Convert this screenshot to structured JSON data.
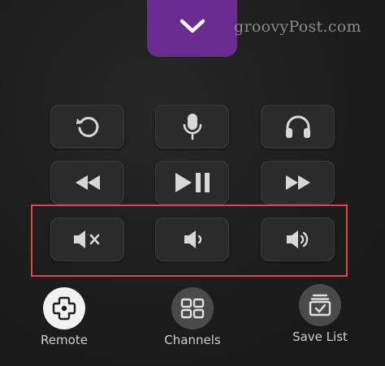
{
  "watermark": "groovyPost.com",
  "colors": {
    "accent": "#6a2c91",
    "highlight": "#e2444b",
    "button_bg": "#2b2b2b",
    "icon": "#d8d8d8"
  },
  "top_button": {
    "icon": "chevron-down-icon"
  },
  "rows": [
    [
      "replay-icon",
      "microphone-icon",
      "headphones-icon"
    ],
    [
      "rewind-icon",
      "play-pause-icon",
      "fast-forward-icon"
    ],
    [
      "mute-icon",
      "volume-down-icon",
      "volume-up-icon"
    ]
  ],
  "bottom_nav": [
    {
      "label": "Remote",
      "icon": "gamepad-icon",
      "active": true
    },
    {
      "label": "Channels",
      "icon": "grid-icon",
      "active": false
    },
    {
      "label": "Save List",
      "icon": "save-list-icon",
      "active": false
    }
  ]
}
